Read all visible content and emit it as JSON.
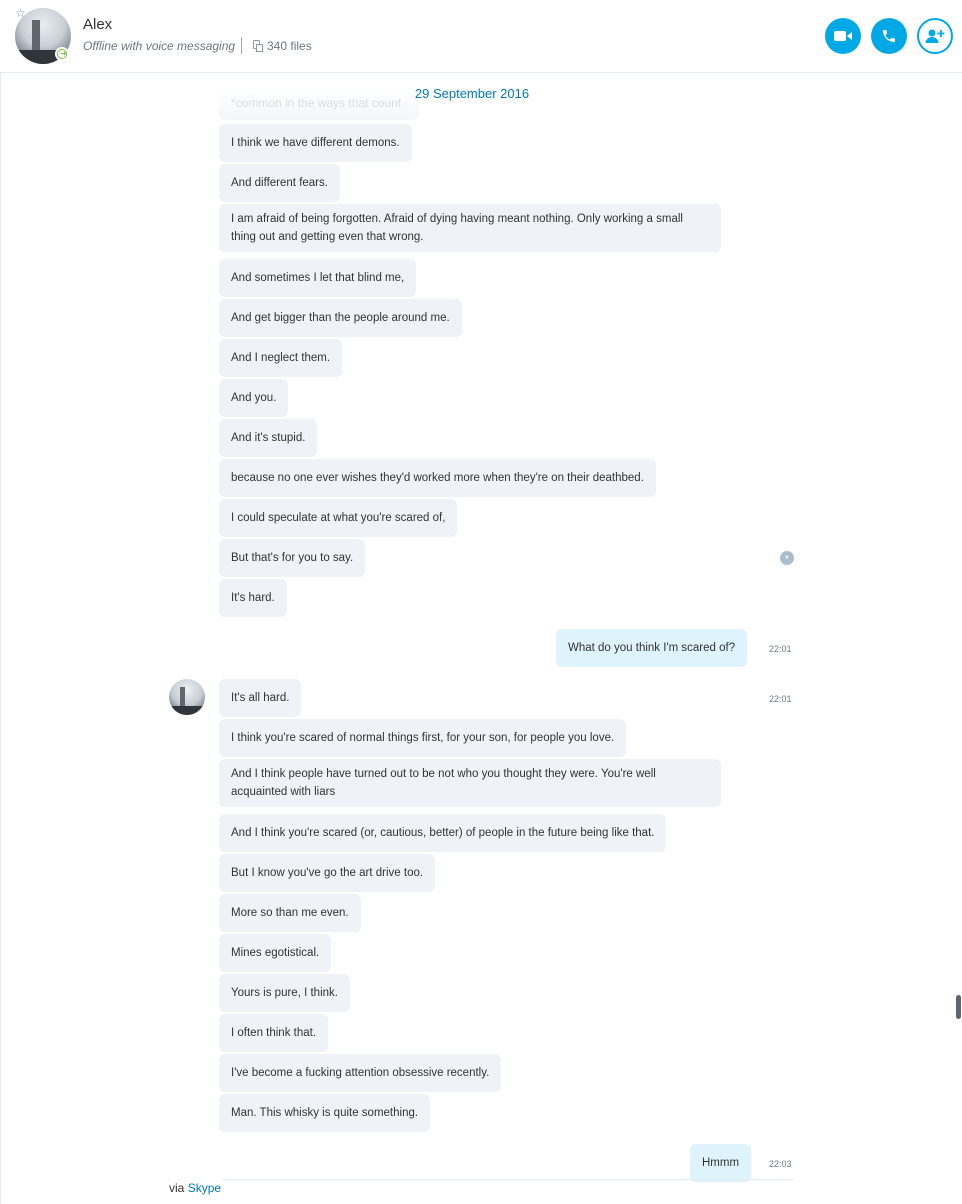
{
  "header": {
    "name": "Alex",
    "status": "Offline with voice messaging",
    "files": "340 files",
    "accent_color": "#00a8e6",
    "buttons": [
      {
        "name": "video-call-button",
        "icon": "video-camera-icon"
      },
      {
        "name": "audio-call-button",
        "icon": "phone-icon"
      },
      {
        "name": "add-people-button",
        "icon": "add-person-icon"
      }
    ]
  },
  "conversation": {
    "date": "29 September 2016",
    "faded_message": "*common in the ways that count",
    "messages_block_1": [
      "I think we have different demons.",
      "And different fears.",
      "I am afraid of being forgotten. Afraid of dying having meant nothing. Only working a small thing out and getting even that wrong.",
      "And sometimes I let that blind me,",
      "And get bigger than the people around me.",
      "And I neglect them.",
      "And you.",
      "And it's stupid.",
      "because no one ever wishes they'd worked more when they're on their deathbed.",
      "I could speculate at what you're scared of,",
      "But that's for you to say.",
      "It's hard."
    ],
    "outgoing_1": {
      "text": "What do you think I'm scared of?",
      "time": "22:01"
    },
    "incoming_first": {
      "text": "It's all hard.",
      "time": "22:01"
    },
    "messages_block_2": [
      "I think you're scared of normal things first, for your son, for people you love.",
      "And I think people have turned out to be not who you thought they were. You're well acquainted with liars",
      "And I think you're scared (or, cautious, better) of people in the future being like that.",
      "But I know you've go the art drive too.",
      "More so than me even.",
      "Mines egotistical.",
      "Yours is pure, I think.",
      "I often think that.",
      "I've become a fucking attention obsessive recently.",
      "Man. This whisky is quite something."
    ],
    "outgoing_2": {
      "text": "Hmmm",
      "time": "22:03"
    }
  },
  "footer": {
    "via_prefix": "via",
    "via_link": "Skype"
  }
}
